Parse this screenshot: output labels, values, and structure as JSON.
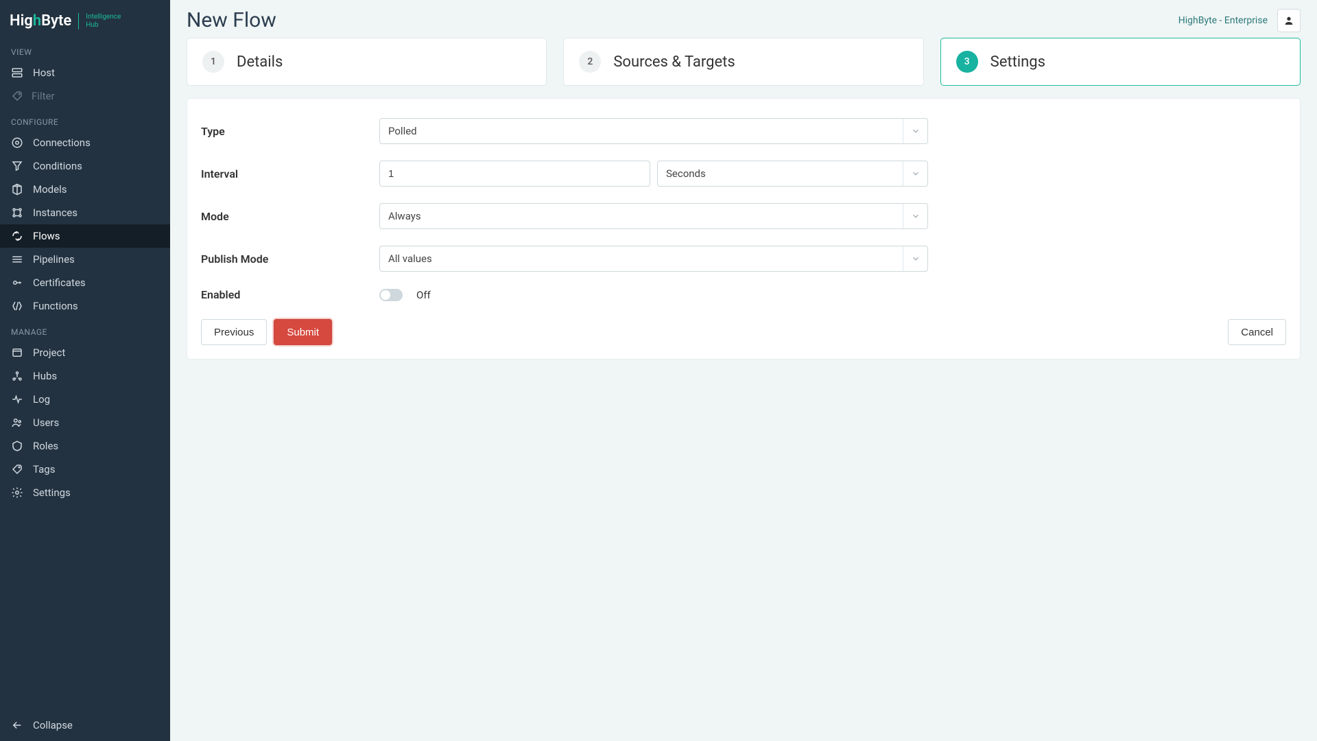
{
  "brand": {
    "name_pre": "Hig",
    "name_accent_h": "h",
    "name_post": "Byte",
    "sub": "Intelligence\nHub"
  },
  "sidebar": {
    "sections": {
      "view": "VIEW",
      "configure": "CONFIGURE",
      "manage": "MANAGE"
    },
    "filter_placeholder": "Filter",
    "items_view": [
      {
        "label": "Host",
        "icon": "host-icon"
      }
    ],
    "items_configure": [
      {
        "label": "Connections",
        "icon": "connections-icon"
      },
      {
        "label": "Conditions",
        "icon": "conditions-icon"
      },
      {
        "label": "Models",
        "icon": "models-icon"
      },
      {
        "label": "Instances",
        "icon": "instances-icon"
      },
      {
        "label": "Flows",
        "icon": "flows-icon",
        "active": true
      },
      {
        "label": "Pipelines",
        "icon": "pipelines-icon"
      },
      {
        "label": "Certificates",
        "icon": "certificates-icon"
      },
      {
        "label": "Functions",
        "icon": "functions-icon"
      }
    ],
    "items_manage": [
      {
        "label": "Project",
        "icon": "project-icon"
      },
      {
        "label": "Hubs",
        "icon": "hubs-icon"
      },
      {
        "label": "Log",
        "icon": "log-icon"
      },
      {
        "label": "Users",
        "icon": "users-icon"
      },
      {
        "label": "Roles",
        "icon": "roles-icon"
      },
      {
        "label": "Tags",
        "icon": "tags-icon"
      },
      {
        "label": "Settings",
        "icon": "settings-icon"
      }
    ],
    "collapse": "Collapse"
  },
  "header": {
    "title": "New Flow",
    "tenant": "HighByte - Enterprise"
  },
  "stepper": [
    {
      "num": "1",
      "label": "Details"
    },
    {
      "num": "2",
      "label": "Sources & Targets"
    },
    {
      "num": "3",
      "label": "Settings",
      "active": true
    }
  ],
  "form": {
    "type_label": "Type",
    "type_value": "Polled",
    "interval_label": "Interval",
    "interval_value": "1",
    "interval_unit": "Seconds",
    "mode_label": "Mode",
    "mode_value": "Always",
    "publish_label": "Publish Mode",
    "publish_value": "All values",
    "enabled_label": "Enabled",
    "enabled_state": "Off"
  },
  "buttons": {
    "previous": "Previous",
    "submit": "Submit",
    "cancel": "Cancel"
  }
}
